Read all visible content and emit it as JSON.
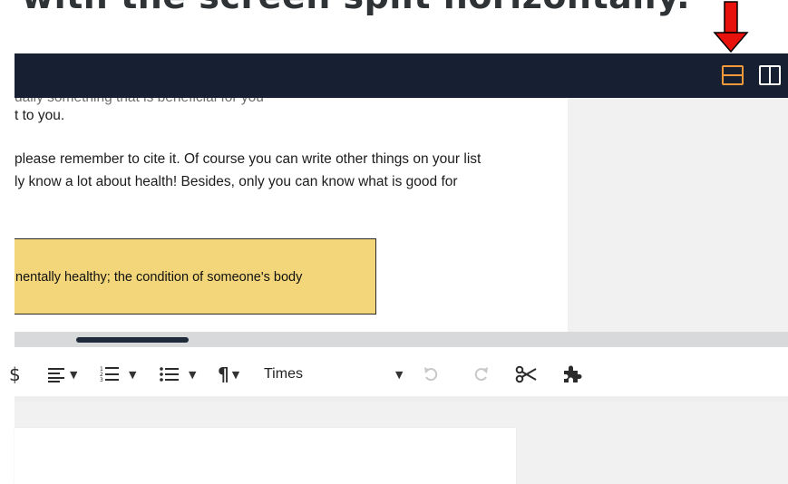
{
  "heading": {
    "text": "with the screen split horizontally."
  },
  "toolbar_top": {
    "horizontal_split_icon": "split-horizontal-icon",
    "vertical_split_icon": "split-vertical-icon",
    "active_color": "#f59a3a",
    "bar_color": "#172032"
  },
  "annotation": {
    "arrow_color": "#e8120c",
    "arrow_icon": "red-arrow-down-icon"
  },
  "document": {
    "clipped_line": "ually something that is beneficial for you",
    "lines": [
      "t to you.",
      "please remember to cite it. Of course you can write other things on your list",
      "ly know a lot about health! Besides, only you can know what is good for"
    ],
    "vocab_box": {
      "text": "nentally healthy; the condition of someone's body",
      "color": "#f2d679"
    }
  },
  "editor_toolbar": {
    "items": [
      {
        "icon": "dollar-icon",
        "glyph": "$"
      },
      {
        "icon": "align-icon",
        "glyph": "≡"
      },
      {
        "icon": "numbered-list-icon",
        "glyph": "☰"
      },
      {
        "icon": "bullet-list-icon",
        "glyph": "☰"
      },
      {
        "icon": "paragraph-icon",
        "glyph": "¶"
      }
    ],
    "font_name": "Times",
    "undo_icon": "undo-icon",
    "redo_icon": "redo-icon",
    "cut_icon": "scissors-icon",
    "plugin_icon": "puzzle-icon"
  }
}
